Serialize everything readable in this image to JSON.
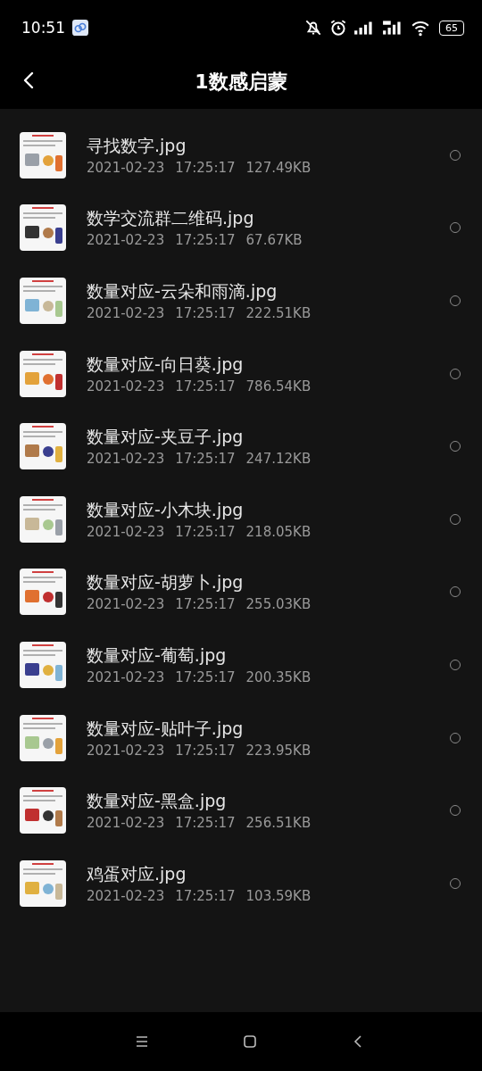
{
  "status_bar": {
    "time": "10:51",
    "battery": "65"
  },
  "header": {
    "title": "1数感启蒙"
  },
  "files": [
    {
      "name": "寻找数字.jpg",
      "date": "2021-02-23",
      "time": "17:25:17",
      "size": "127.49KB",
      "selected": false
    },
    {
      "name": "数学交流群二维码.jpg",
      "date": "2021-02-23",
      "time": "17:25:17",
      "size": "67.67KB",
      "selected": false
    },
    {
      "name": "数量对应-云朵和雨滴.jpg",
      "date": "2021-02-23",
      "time": "17:25:17",
      "size": "222.51KB",
      "selected": false
    },
    {
      "name": "数量对应-向日葵.jpg",
      "date": "2021-02-23",
      "time": "17:25:17",
      "size": "786.54KB",
      "selected": false
    },
    {
      "name": "数量对应-夹豆子.jpg",
      "date": "2021-02-23",
      "time": "17:25:17",
      "size": "247.12KB",
      "selected": false
    },
    {
      "name": "数量对应-小木块.jpg",
      "date": "2021-02-23",
      "time": "17:25:17",
      "size": "218.05KB",
      "selected": false
    },
    {
      "name": "数量对应-胡萝卜.jpg",
      "date": "2021-02-23",
      "time": "17:25:17",
      "size": "255.03KB",
      "selected": false
    },
    {
      "name": "数量对应-葡萄.jpg",
      "date": "2021-02-23",
      "time": "17:25:17",
      "size": "200.35KB",
      "selected": false
    },
    {
      "name": "数量对应-贴叶子.jpg",
      "date": "2021-02-23",
      "time": "17:25:17",
      "size": "223.95KB",
      "selected": false
    },
    {
      "name": "数量对应-黑盒.jpg",
      "date": "2021-02-23",
      "time": "17:25:17",
      "size": "256.51KB",
      "selected": false
    },
    {
      "name": "鸡蛋对应.jpg",
      "date": "2021-02-23",
      "time": "17:25:17",
      "size": "103.59KB",
      "selected": false
    }
  ]
}
